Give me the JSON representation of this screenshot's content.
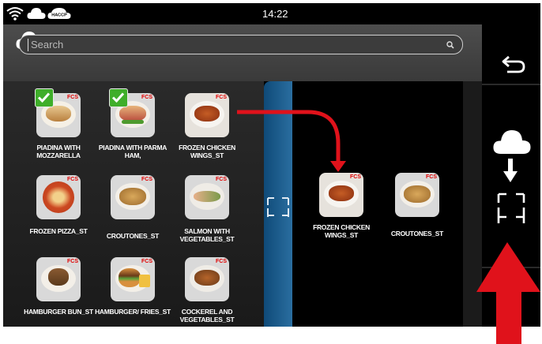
{
  "status": {
    "time": "14:22",
    "icons": [
      "wifi-icon",
      "cloud-icon",
      "haccp-cloud-icon"
    ],
    "haccp_text": "HACCP"
  },
  "header": {
    "icon": "cloud-icon"
  },
  "search": {
    "placeholder": "Search",
    "icon": "search-icon"
  },
  "toolbar": {
    "back_icon": "back-icon",
    "download_icon": "cloud-download-icon"
  },
  "badge": "FCS",
  "products": [
    {
      "label": "PIADINA WITH MOZZARELLA",
      "checked": true
    },
    {
      "label": "PIADINA WITH PARMA HAM,",
      "checked": true
    },
    {
      "label": "FROZEN CHICKEN WINGS_ST",
      "checked": false
    },
    {
      "label": "FROZEN PIZZA_ST",
      "checked": false
    },
    {
      "label": "CROUTONES_ST",
      "checked": false
    },
    {
      "label": "SALMON WITH VEGETABLES_ST",
      "checked": false
    },
    {
      "label": "HAMBURGER BUN_ST",
      "checked": false
    },
    {
      "label": "HAMBURGER/ FRIES_ST",
      "checked": false
    },
    {
      "label": "COCKEREL AND VEGETABLES_ST",
      "checked": false
    }
  ],
  "selected": [
    {
      "label": "FROZEN CHICKEN WINGS_ST"
    },
    {
      "label": "CROUTONES_ST"
    }
  ],
  "colors": {
    "accent_blue": "#1a5c8e",
    "check_green": "#3fae2a",
    "arrow_red": "#e0121b",
    "fcs_red": "#e00000"
  }
}
